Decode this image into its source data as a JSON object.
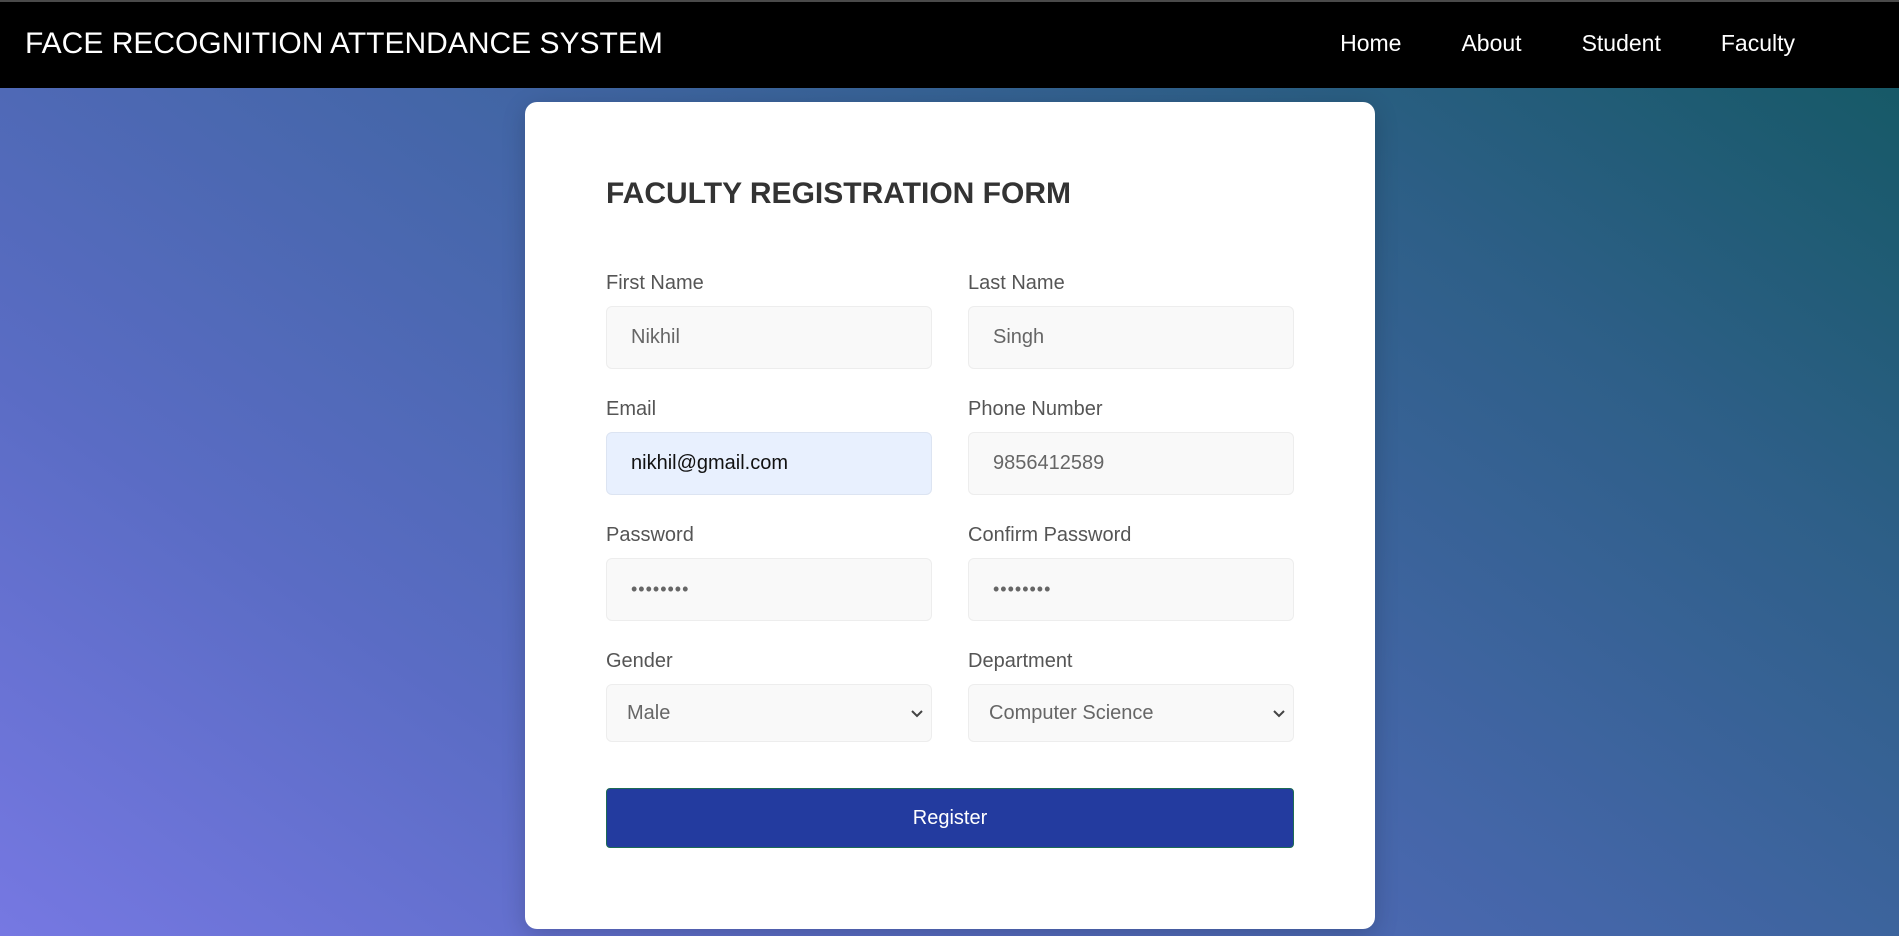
{
  "navbar": {
    "brand": "FACE RECOGNITION ATTENDANCE SYSTEM",
    "links": [
      {
        "label": "Home"
      },
      {
        "label": "About"
      },
      {
        "label": "Student"
      },
      {
        "label": "Faculty"
      }
    ]
  },
  "form": {
    "title": "FACULTY REGISTRATION FORM",
    "fields": {
      "first_name": {
        "label": "First Name",
        "value": "Nikhil"
      },
      "last_name": {
        "label": "Last Name",
        "value": "Singh"
      },
      "email": {
        "label": "Email",
        "value": "nikhil@gmail.com"
      },
      "phone": {
        "label": "Phone Number",
        "value": "9856412589"
      },
      "password": {
        "label": "Password",
        "value": "••••••••"
      },
      "confirm_password": {
        "label": "Confirm Password",
        "value": "••••••••"
      },
      "gender": {
        "label": "Gender",
        "selected": "Male"
      },
      "department": {
        "label": "Department",
        "selected": "Computer Science"
      }
    },
    "submit_label": "Register"
  },
  "colors": {
    "navbar_bg": "#000000",
    "button_bg": "#233b9f",
    "gradient_start": "#7678e2",
    "gradient_end": "#125861",
    "autofill_bg": "#e8f0fe"
  }
}
